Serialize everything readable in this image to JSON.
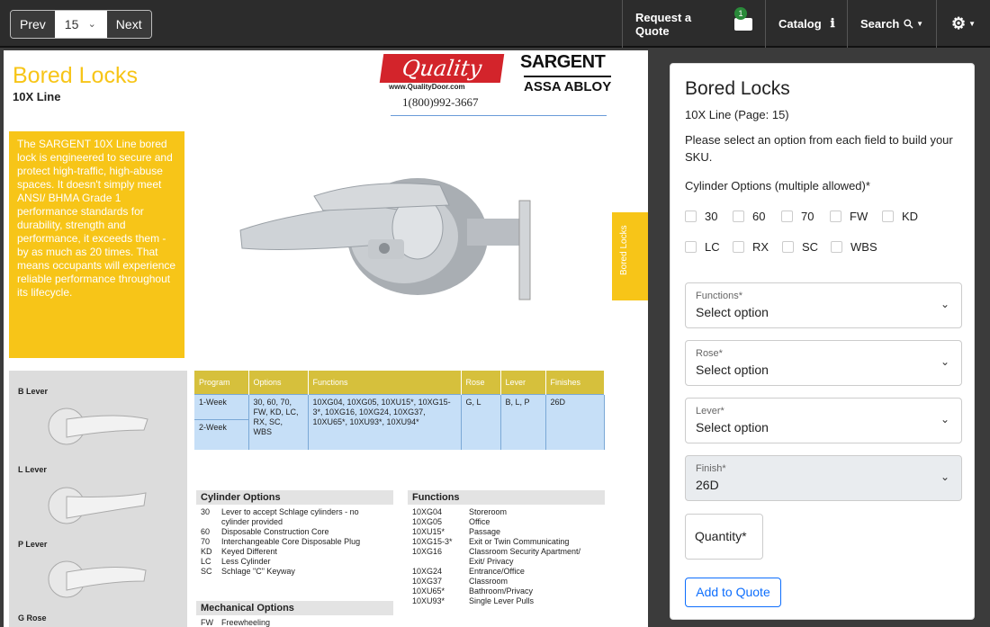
{
  "toolbar": {
    "prev_label": "Prev",
    "page_value": "15",
    "next_label": "Next",
    "quote_label": "Request a Quote",
    "quote_count": "1",
    "catalog_label": "Catalog",
    "search_label": "Search"
  },
  "document": {
    "title": "Bored Locks",
    "subtitle": "10X Line",
    "quality_logo": "Quality",
    "quality_url": "www.QualityDoor.com",
    "phone": "1(800)992-3667",
    "sargent_logo": "SARGENT",
    "assa_logo": "ASSA ABLOY",
    "intro": "The SARGENT 10X Line bored lock is engineered to secure and protect high-traffic, high-abuse spaces. It doesn't simply meet ANSI/ BHMA Grade 1 performance standards for durability, strength and performance, it exceeds them - by as much as 20 times. That means occupants will experience reliable performance throughout its lifecycle.",
    "side_tab": "Bored Locks",
    "levers": [
      "B Lever",
      "L Lever",
      "P Lever",
      "G Rose"
    ],
    "spec_table": {
      "headers": [
        "Program",
        "Options",
        "Functions",
        "Rose",
        "Lever",
        "Finishes"
      ],
      "rows": [
        [
          "1-Week",
          "30, 60, 70, FW, KD, LC, RX, SC, WBS",
          "10XG04, 10XG05, 10XU15*, 10XG15-3*, 10XG16, 10XG24, 10XG37, 10XU65*, 10XU93*, 10XU94*",
          "G, L",
          "B, L, P",
          "26D"
        ],
        [
          "2-Week",
          "",
          "",
          "",
          "",
          ""
        ]
      ]
    },
    "cylinder_options": {
      "heading": "Cylinder Options",
      "items": [
        {
          "code": "30",
          "desc": "Lever to accept Schlage cylinders - no cylinder provided"
        },
        {
          "code": "60",
          "desc": "Disposable Construction Core"
        },
        {
          "code": "70",
          "desc": "Interchangeable Core Disposable Plug"
        },
        {
          "code": "KD",
          "desc": "Keyed Different"
        },
        {
          "code": "LC",
          "desc": "Less Cylinder"
        },
        {
          "code": "SC",
          "desc": "Schlage \"C\" Keyway"
        }
      ]
    },
    "mechanical_options": {
      "heading": "Mechanical Options",
      "items": [
        {
          "code": "FW",
          "desc": "Freewheeling"
        }
      ]
    },
    "functions": {
      "heading": "Functions",
      "items": [
        {
          "code": "10XG04",
          "desc": "Storeroom"
        },
        {
          "code": "10XG05",
          "desc": "Office"
        },
        {
          "code": "10XU15*",
          "desc": "Passage"
        },
        {
          "code": "10XG15-3*",
          "desc": "Exit or Twin Communicating"
        },
        {
          "code": "10XG16",
          "desc": "Classroom Security Apartment/ Exit/ Privacy"
        },
        {
          "code": "10XG24",
          "desc": "Entrance/Office"
        },
        {
          "code": "10XG37",
          "desc": "Classroom"
        },
        {
          "code": "10XU65*",
          "desc": "Bathroom/Privacy"
        },
        {
          "code": "10XU93*",
          "desc": "Single Lever Pulls"
        }
      ]
    }
  },
  "panel": {
    "title": "Bored Locks",
    "subtitle": "10X Line (Page: 15)",
    "instructions": "Please select an option from each field to build your SKU.",
    "cylinder_label": "Cylinder Options (multiple allowed)*",
    "cylinder_options": [
      "30",
      "60",
      "70",
      "FW",
      "KD",
      "LC",
      "RX",
      "SC",
      "WBS"
    ],
    "fields": [
      {
        "label": "Functions*",
        "value": "Select option"
      },
      {
        "label": "Rose*",
        "value": "Select option"
      },
      {
        "label": "Lever*",
        "value": "Select option"
      },
      {
        "label": "Finish*",
        "value": "26D"
      }
    ],
    "quantity_label": "Quantity*",
    "add_label": "Add to Quote"
  },
  "colors": {
    "accent": "#f7c518",
    "table_blue": "#c6dff7",
    "brand_red": "#d3242b",
    "link_blue": "#0d6efd"
  },
  "icons": [
    "chevron-down-icon",
    "info-icon",
    "search-icon",
    "gear-icon",
    "quote-box-icon",
    "checkbox-icon"
  ]
}
